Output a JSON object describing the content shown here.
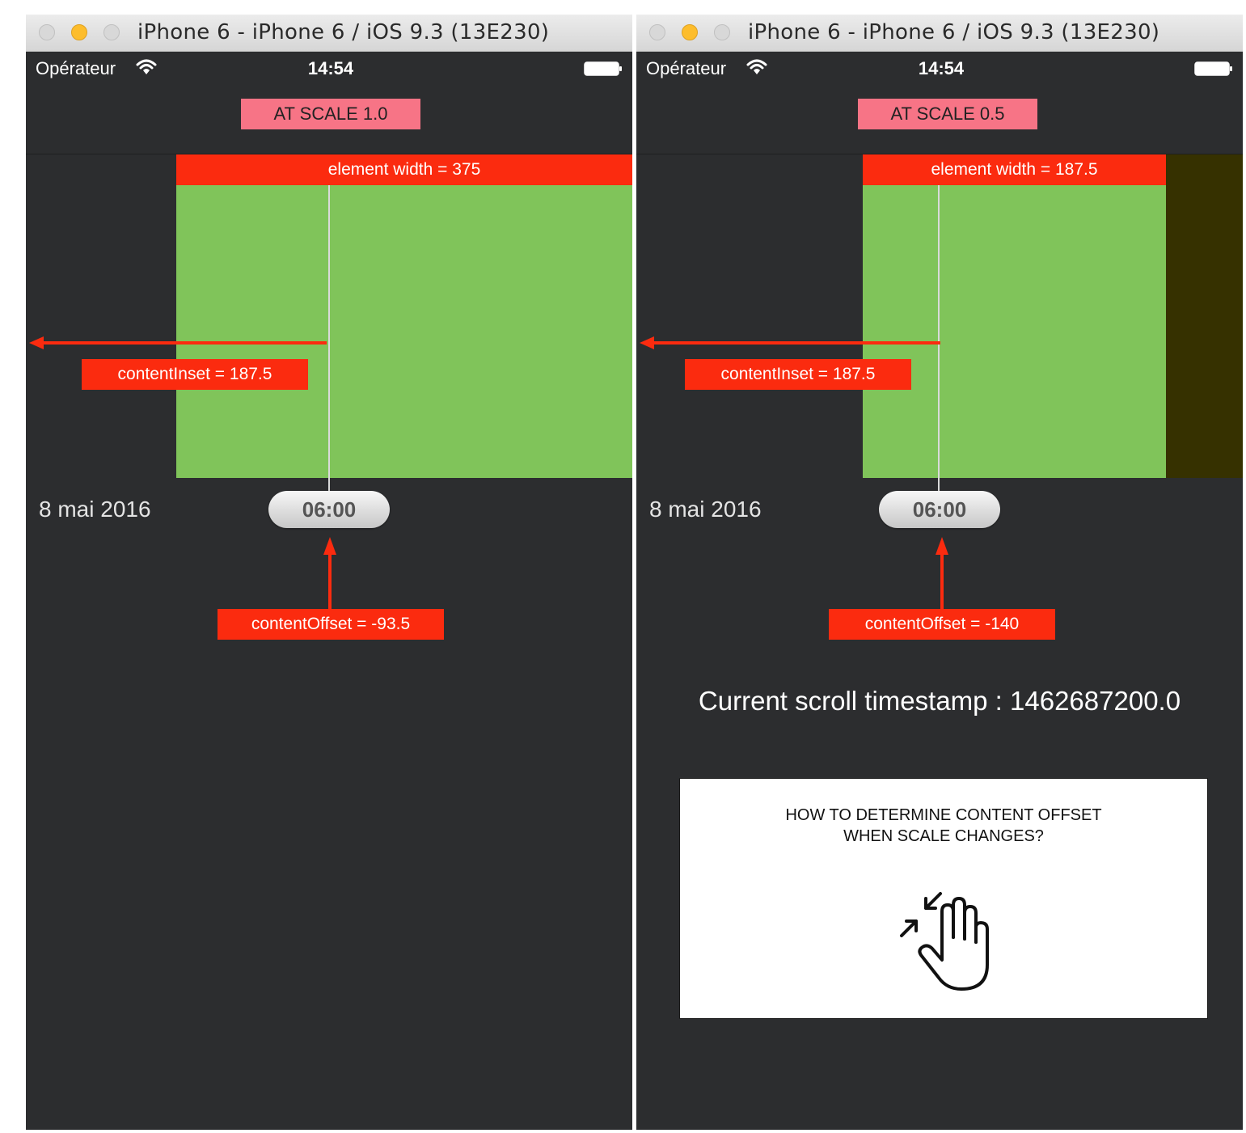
{
  "colors": {
    "background": "#2c2d2f",
    "scale_badge": "#f77486",
    "annotation_red": "#fb2b0f",
    "content_green": "#80c45a",
    "offscreen_olive": "#363100",
    "traffic_yellow": "#fdbd2c"
  },
  "left": {
    "window_title": "iPhone 6 - iPhone 6 / iOS 9.3 (13E230)",
    "status": {
      "carrier": "Opérateur",
      "time": "14:54"
    },
    "scale_badge": "AT SCALE 1.0",
    "element_width_label": "element width = 375",
    "content_inset_label": "contentInset = 187.5",
    "date": "8 mai 2016",
    "time_pill": "06:00",
    "content_offset_label": "contentOffset = -93.5"
  },
  "right": {
    "window_title": "iPhone 6 - iPhone 6 / iOS 9.3 (13E230)",
    "status": {
      "carrier": "Opérateur",
      "time": "14:54"
    },
    "scale_badge": "AT SCALE 0.5",
    "element_width_label": "element width = 187.5",
    "content_inset_label": "contentInset = 187.5",
    "date": "8 mai 2016",
    "time_pill": "06:00",
    "content_offset_label": "contentOffset = -140",
    "timestamp_label": "Current scroll timestamp : 1462687200.0",
    "question": {
      "line1": "HOW TO DETERMINE CONTENT OFFSET",
      "line2": "WHEN SCALE CHANGES?",
      "icon": "pinch-gesture-icon"
    }
  },
  "icons": [
    "wifi-icon",
    "battery-icon",
    "pinch-gesture-icon",
    "arrow-left-icon",
    "arrow-up-icon"
  ]
}
